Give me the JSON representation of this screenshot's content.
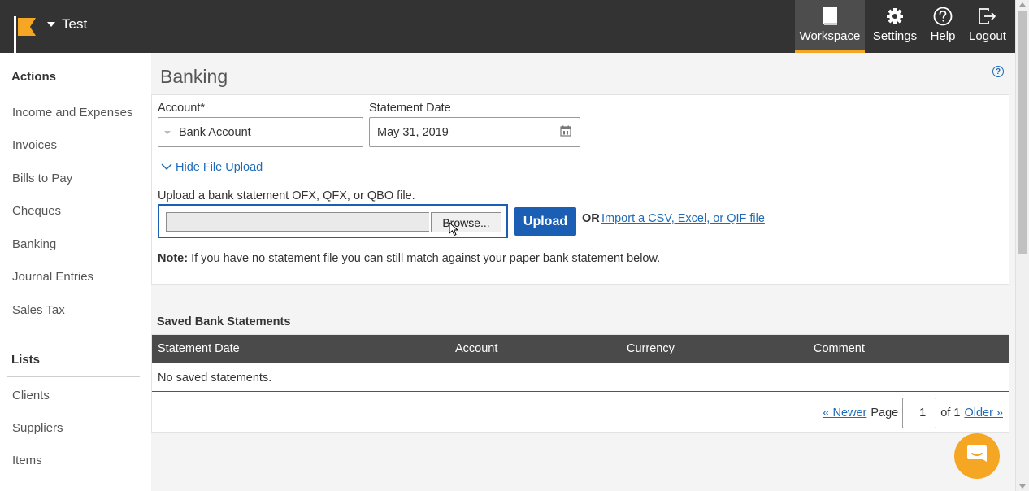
{
  "header": {
    "org_name": "Test",
    "nav": {
      "workspace": "Workspace",
      "settings": "Settings",
      "help": "Help",
      "logout": "Logout"
    },
    "accent_color": "#f5a623"
  },
  "sidebar": {
    "actions_title": "Actions",
    "actions": [
      "Income and Expenses",
      "Invoices",
      "Bills to Pay",
      "Cheques",
      "Banking",
      "Journal Entries",
      "Sales Tax"
    ],
    "lists_title": "Lists",
    "lists": [
      "Clients",
      "Suppliers",
      "Items"
    ]
  },
  "main": {
    "title": "Banking",
    "help_icon": "?",
    "account_label": "Account*",
    "account_value": "Bank Account",
    "date_label": "Statement Date",
    "date_value": "May 31, 2019",
    "toggle_upload": "Hide File Upload",
    "upload_hint": "Upload a bank statement OFX, QFX, or QBO file.",
    "browse_label": "Browse...",
    "upload_label": "Upload",
    "or_label": "OR",
    "import_link": "Import a CSV, Excel, or QIF file",
    "note_label": "Note:",
    "note_text": " If you have no statement file you can still match against your paper bank statement below."
  },
  "saved": {
    "title": "Saved Bank Statements",
    "columns": [
      "Statement Date",
      "Account",
      "Currency",
      "Comment"
    ],
    "empty_text": "No saved statements.",
    "pager": {
      "newer": "« Newer",
      "page_label": "Page",
      "page_value": "1",
      "of_label": "of 1",
      "older": "Older »"
    }
  },
  "colors": {
    "primary_blue": "#1a5fb4",
    "link_blue": "#1f6bb8",
    "header_bg": "#333333"
  }
}
